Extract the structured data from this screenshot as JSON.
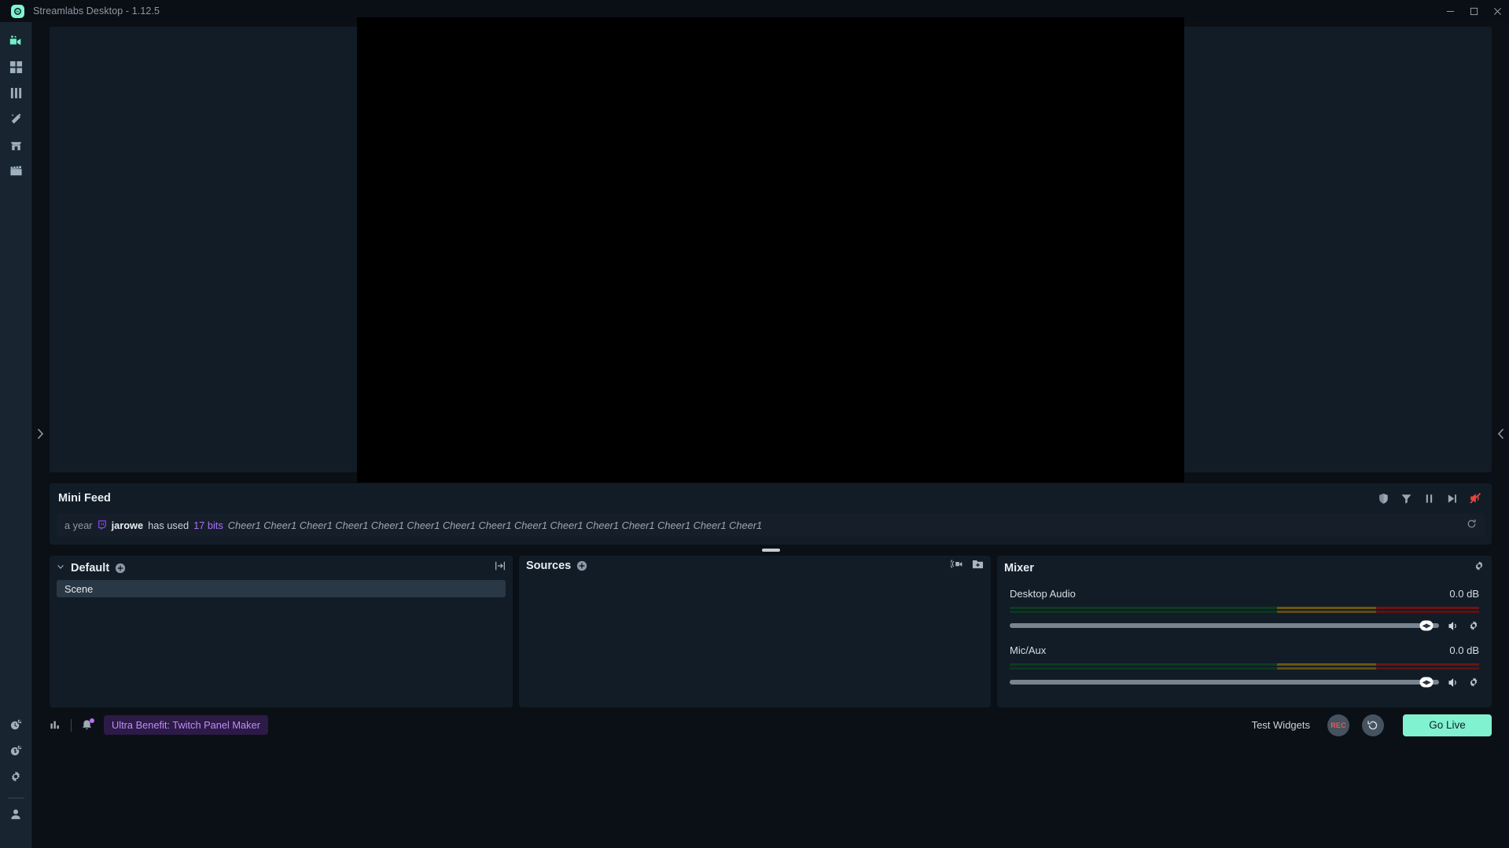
{
  "window": {
    "title": "Streamlabs Desktop - 1.12.5",
    "logo_icon": "streamlabs-logo-icon",
    "controls": {
      "minimize": "minimize-icon",
      "maximize": "maximize-icon",
      "close": "close-icon"
    }
  },
  "nav": {
    "top_items": [
      {
        "icon": "video-camera-icon",
        "label": "Editor",
        "active": true
      },
      {
        "icon": "dashboard-grid-icon",
        "label": "Dashboard",
        "active": false
      },
      {
        "icon": "bar-columns-icon",
        "label": "Analytics",
        "active": false
      },
      {
        "icon": "magic-wand-icon",
        "label": "Themes",
        "active": false
      },
      {
        "icon": "store-icon",
        "label": "Store",
        "active": false
      },
      {
        "icon": "clapperboard-icon",
        "label": "Highlighter",
        "active": false
      }
    ],
    "bottom_items": [
      {
        "icon": "alertbox-link-icon",
        "label": "Alert Box"
      },
      {
        "icon": "tips-link-icon",
        "label": "Tips"
      },
      {
        "icon": "gear-icon",
        "label": "Settings"
      },
      {
        "icon": "user-icon",
        "label": "Account"
      }
    ]
  },
  "edges": {
    "left_handle": "chevron-right-icon",
    "right_handle": "chevron-left-icon"
  },
  "mini_feed": {
    "title": "Mini Feed",
    "header_icons": [
      {
        "icon": "shield-icon",
        "name": "moderation-shield"
      },
      {
        "icon": "filter-icon",
        "name": "filter-events"
      },
      {
        "icon": "pause-icon",
        "name": "pause-feed"
      },
      {
        "icon": "skip-forward-icon",
        "name": "skip-alert"
      },
      {
        "icon": "mute-alert-icon",
        "name": "mute-alerts",
        "color": "#e8453c"
      }
    ],
    "events": [
      {
        "time": "a year",
        "platform_icon": "twitch-icon",
        "user": "jarowe",
        "verb": "has used",
        "amount": "17 bits",
        "message": "Cheer1 Cheer1 Cheer1 Cheer1 Cheer1 Cheer1 Cheer1 Cheer1 Cheer1 Cheer1 Cheer1 Cheer1 Cheer1 Cheer1 Cheer1",
        "refresh_icon": "refresh-icon"
      }
    ]
  },
  "scenes": {
    "collection_label": "Default",
    "chevron_icon": "chevron-down-icon",
    "add_icon": "plus-circle-icon",
    "header_right_icon": "fit-to-screen-icon",
    "items": [
      {
        "name": "Scene",
        "selected": true
      }
    ]
  },
  "sources": {
    "title": "Sources",
    "add_icon": "plus-circle-icon",
    "header_icons": [
      {
        "icon": "camera-broadcast-icon",
        "name": "add-capture-source"
      },
      {
        "icon": "add-folder-icon",
        "name": "add-source-folder"
      }
    ],
    "items": []
  },
  "mixer": {
    "title": "Mixer",
    "settings_icon": "gear-icon",
    "channels": [
      {
        "name": "Desktop Audio",
        "db": "0.0 dB",
        "volume_percent": 97,
        "speaker_icon": "speaker-icon",
        "gear_icon": "gear-icon"
      },
      {
        "name": "Mic/Aux",
        "db": "0.0 dB",
        "volume_percent": 97,
        "speaker_icon": "speaker-icon",
        "gear_icon": "gear-icon"
      }
    ]
  },
  "statusbar": {
    "performance_icon": "bar-chart-icon",
    "notifications_icon": "bell-icon",
    "ultra_badge": "Ultra Benefit: Twitch Panel Maker",
    "test_widgets_label": "Test Widgets",
    "record_label": "REC",
    "replay_icon": "replay-buffer-icon",
    "go_live_label": "Go Live"
  },
  "colors": {
    "accent_mint": "#81f2cf",
    "accent_purple": "#9146ff",
    "danger_red": "#e8453c",
    "panel_bg": "#111c26",
    "app_bg": "#0b1016",
    "nav_bg": "#182430"
  }
}
